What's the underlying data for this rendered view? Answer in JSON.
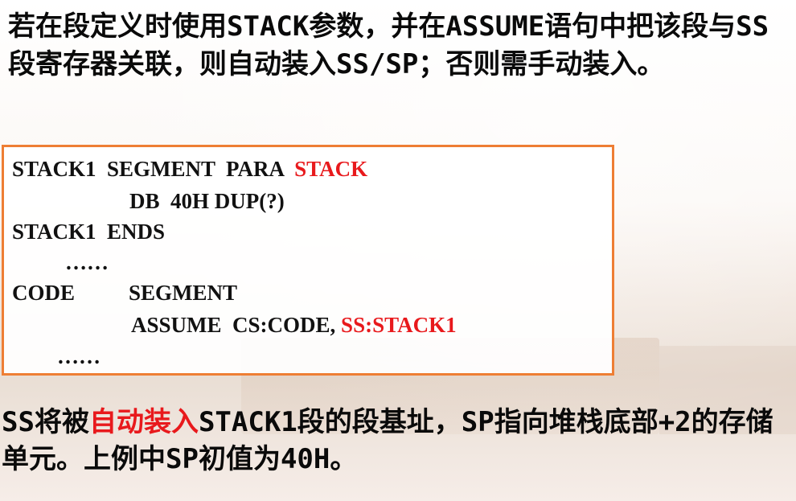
{
  "intro": "若在段定义时使用STACK参数，并在ASSUME语句中把该段与SS段寄存器关联，则自动装入SS/SP；否则需手动装入。",
  "code": {
    "line1_a": "STACK1  SEGMENT  PARA  ",
    "line1_b": "STACK",
    "line2": "DB  40H DUP(?)",
    "line3": "STACK1  ENDS",
    "line4": "……",
    "line5_a": "CODE",
    "line5_b": "SEGMENT",
    "line6_a": "ASSUME  CS:CODE, ",
    "line6_b": "SS:STACK1",
    "line7": "……"
  },
  "outro": {
    "part1": "SS将被",
    "part2": "自动装入",
    "part3": "STACK1段的段基址，SP指向堆栈底部+2的存储单元。上例中SP初值为40H。"
  },
  "colors": {
    "highlight": "#e8191c",
    "box_border": "#ee7e34"
  }
}
